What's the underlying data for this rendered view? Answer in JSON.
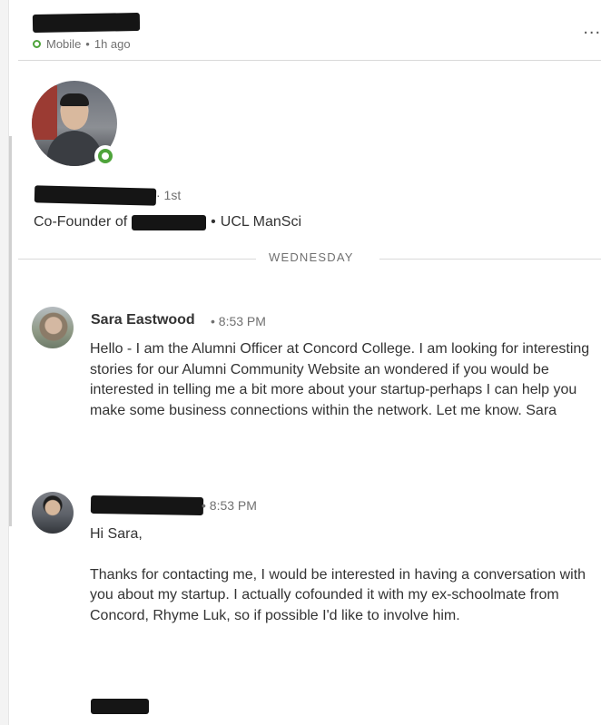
{
  "header": {
    "status_dot_color": "#4fa43b",
    "device": "Mobile",
    "separator": "•",
    "last_active": "1h ago",
    "more_icon": "more-options-icon",
    "more_label": "..."
  },
  "profile": {
    "connection_degree": "· 1st",
    "headline_prefix": "Co-Founder of",
    "headline_sep": "•",
    "headline_suffix": "UCL ManSci",
    "presence_color": "#4fa43b"
  },
  "thread": {
    "day_divider": "WEDNESDAY",
    "messages": [
      {
        "sender": "Sara Eastwood",
        "time": "• 8:53 PM",
        "paragraphs": [
          "Hello - I am the Alumni Officer at Concord College. I am looking for interesting stories for our Alumni Community Website an wondered if you would be interested in telling me a bit more about your startup-perhaps I can help you make some business connections within the network. Let me know. Sara"
        ]
      },
      {
        "sender": "",
        "time": "• 8:53 PM",
        "paragraphs": [
          "Hi Sara,",
          "Thanks for contacting me, I would be interested in having a conversation with you about my startup. I actually cofounded it with my ex-schoolmate from Concord, Rhyme Luk, so if possible I'd like to involve him."
        ]
      }
    ]
  }
}
